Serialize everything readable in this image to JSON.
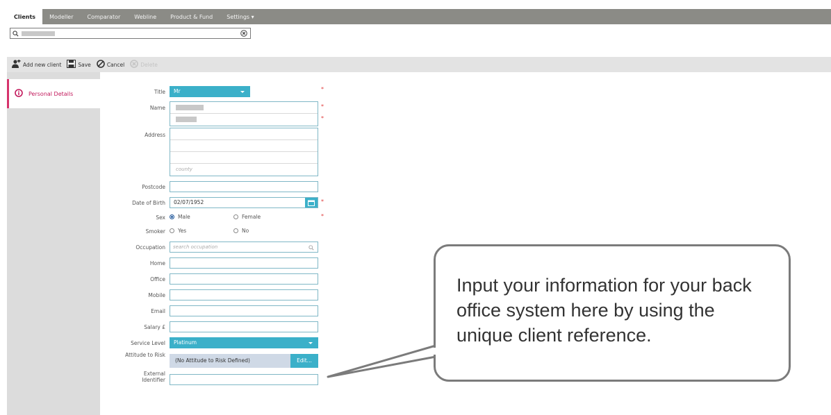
{
  "nav": {
    "tabs": [
      {
        "label": "Clients"
      },
      {
        "label": "Modeller"
      },
      {
        "label": "Comparator"
      },
      {
        "label": "Webline"
      },
      {
        "label": "Product & Fund"
      },
      {
        "label": "Settings ▾"
      }
    ]
  },
  "search": {
    "value": ""
  },
  "toolbar": {
    "add_label": "Add new client",
    "save_label": "Save",
    "cancel_label": "Cancel",
    "delete_label": "Delete"
  },
  "sidebar": {
    "items": [
      {
        "label": "Personal Details",
        "icon": "info-icon"
      }
    ]
  },
  "form": {
    "title": {
      "label": "Title",
      "value": "Mr"
    },
    "name": {
      "label": "Name"
    },
    "address": {
      "label": "Address",
      "county_placeholder": "county"
    },
    "postcode": {
      "label": "Postcode"
    },
    "dob": {
      "label": "Date of Birth",
      "value": "02/07/1952"
    },
    "sex": {
      "label": "Sex",
      "options": [
        "Male",
        "Female"
      ],
      "selected": "Male"
    },
    "smoker": {
      "label": "Smoker",
      "options": [
        "Yes",
        "No"
      ]
    },
    "occupation": {
      "label": "Occupation",
      "placeholder": "search occupation"
    },
    "home": {
      "label": "Home"
    },
    "office": {
      "label": "Office"
    },
    "mobile": {
      "label": "Mobile"
    },
    "email": {
      "label": "Email"
    },
    "salary": {
      "label": "Salary £"
    },
    "service_level": {
      "label": "Service Level",
      "value": "Platinum"
    },
    "attitude": {
      "label": "Attitude to Risk",
      "value": "(No Attitude to Risk Defined)",
      "edit_label": "Edit..."
    },
    "external": {
      "label": "External Identifier"
    },
    "required_marker": "*"
  },
  "callout": {
    "text": "Input your information for your back office system here by using the unique client reference."
  },
  "colors": {
    "accent": "#3bb0c9",
    "nav_bg": "#8b8b86",
    "required": "#e03c3c",
    "side_accent": "#d6336c"
  }
}
